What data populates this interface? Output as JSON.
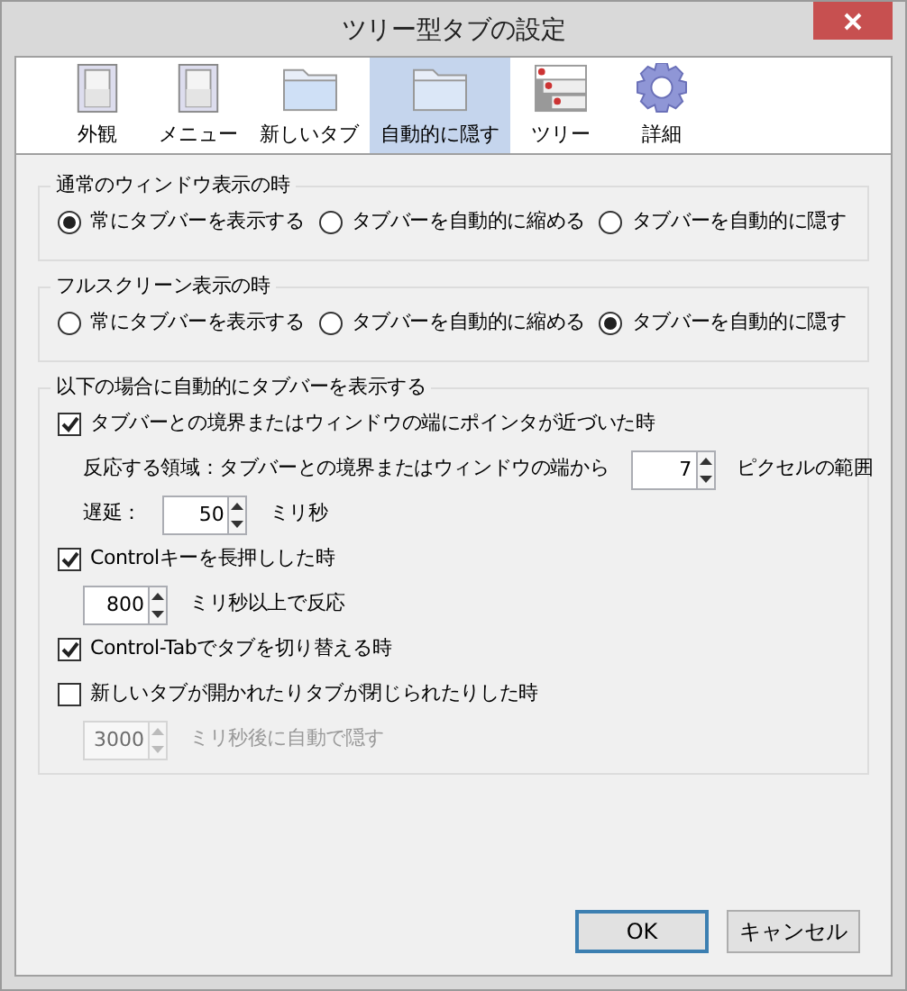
{
  "window": {
    "title": "ツリー型タブの設定"
  },
  "tabs": [
    {
      "label": "外観",
      "selected": false
    },
    {
      "label": "メニュー",
      "selected": false
    },
    {
      "label": "新しいタブ",
      "selected": false
    },
    {
      "label": "自動的に隠す",
      "selected": true
    },
    {
      "label": "ツリー",
      "selected": false
    },
    {
      "label": "詳細",
      "selected": false
    }
  ],
  "normal_window": {
    "title": "通常のウィンドウ表示の時",
    "options": [
      {
        "label": "常にタブバーを表示する",
        "selected": true
      },
      {
        "label": "タブバーを自動的に縮める",
        "selected": false
      },
      {
        "label": "タブバーを自動的に隠す",
        "selected": false
      }
    ]
  },
  "fullscreen": {
    "title": "フルスクリーン表示の時",
    "options": [
      {
        "label": "常にタブバーを表示する",
        "selected": false
      },
      {
        "label": "タブバーを自動的に縮める",
        "selected": false
      },
      {
        "label": "タブバーを自動的に隠す",
        "selected": true
      }
    ]
  },
  "auto_show": {
    "title": "以下の場合に自動的にタブバーを表示する",
    "items": [
      {
        "label": "タブバーとの境界またはウィンドウの端にポインタが近づいた時",
        "checked": true,
        "children": [
          {
            "prefix": "反応する領域：タブバーとの境界またはウィンドウの端から",
            "value": "7",
            "suffix": "ピクセルの範囲",
            "disabled": false
          },
          {
            "prefix": "遅延：",
            "value": "50",
            "suffix": "ミリ秒",
            "disabled": false
          }
        ]
      },
      {
        "label": "Controlキーを長押しした時",
        "checked": true,
        "children": [
          {
            "value": "800",
            "suffix": "ミリ秒以上で反応",
            "disabled": false
          }
        ]
      },
      {
        "label": "Control-Tabでタブを切り替える時",
        "checked": true
      },
      {
        "label": "新しいタブが開かれたりタブが閉じられたりした時",
        "checked": false,
        "children": [
          {
            "value": "3000",
            "suffix": "ミリ秒後に自動で隠す",
            "disabled": true
          }
        ]
      }
    ]
  },
  "buttons": [
    {
      "label": "OK",
      "default": true
    },
    {
      "label": "キャンセル",
      "default": false
    }
  ]
}
